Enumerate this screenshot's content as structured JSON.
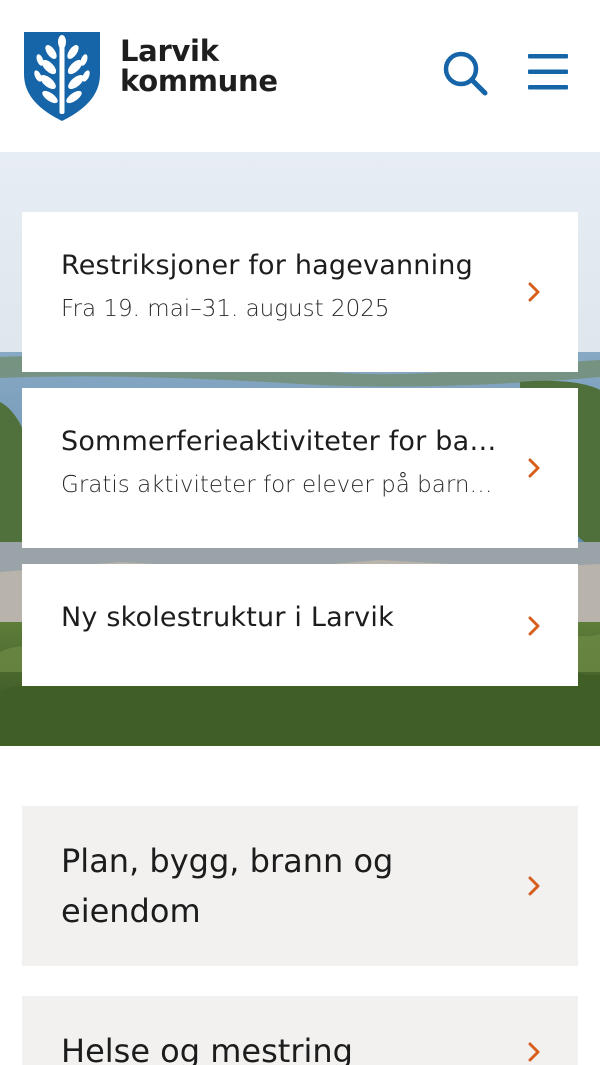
{
  "header": {
    "logo_line1": "Larvik",
    "logo_line2": "kommune",
    "logo_icon": "tree-shield-icon",
    "search_icon": "search-icon",
    "menu_icon": "hamburger-menu-icon",
    "brand_color": "#1565a8",
    "accent_color": "#d75f1e"
  },
  "hero": {
    "cards": [
      {
        "title": "Restriksjoner for hagevanning",
        "subtitle": "Fra 19. mai–31. august 2025"
      },
      {
        "title": "Sommerferieaktiviteter for barn og unge",
        "subtitle": "Gratis aktiviteter for elever på barneskolen"
      },
      {
        "title": "Ny skolestruktur i Larvik",
        "subtitle": ""
      }
    ]
  },
  "categories": [
    {
      "title": "Plan, bygg, brann og eiendom"
    },
    {
      "title": "Helse og mestring"
    }
  ]
}
